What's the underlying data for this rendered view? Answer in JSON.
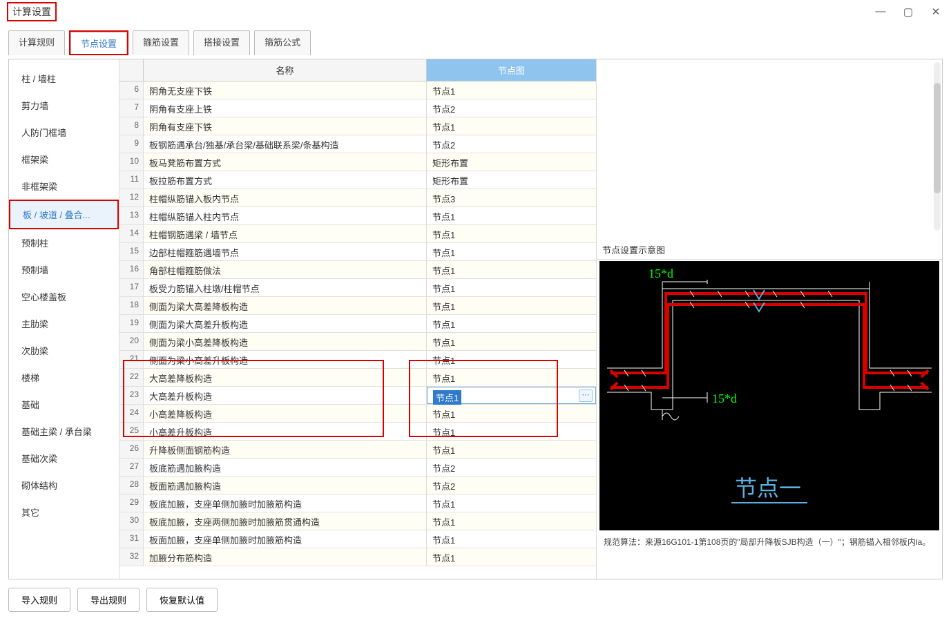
{
  "window": {
    "title": "计算设置"
  },
  "tabs": [
    "计算规则",
    "节点设置",
    "箍筋设置",
    "搭接设置",
    "箍筋公式"
  ],
  "active_tab_index": 1,
  "sidebar": {
    "items": [
      "柱 / 墙柱",
      "剪力墙",
      "人防门框墙",
      "框架梁",
      "非框架梁",
      "板 / 坡道 / 叠合...",
      "预制柱",
      "预制墙",
      "空心楼盖板",
      "主肋梁",
      "次肋梁",
      "楼梯",
      "基础",
      "基础主梁 / 承台梁",
      "基础次梁",
      "砌体结构",
      "其它"
    ],
    "active_index": 5
  },
  "table": {
    "header_name": "名称",
    "header_node": "节点图",
    "rows": [
      {
        "n": 6,
        "name": "阴角无支座下铁",
        "node": "节点1"
      },
      {
        "n": 7,
        "name": "阴角有支座上铁",
        "node": "节点2"
      },
      {
        "n": 8,
        "name": "阴角有支座下铁",
        "node": "节点1"
      },
      {
        "n": 9,
        "name": "板钢筋遇承台/独基/承台梁/基础联系梁/条基构造",
        "node": "节点2"
      },
      {
        "n": 10,
        "name": "板马凳筋布置方式",
        "node": "矩形布置"
      },
      {
        "n": 11,
        "name": "板拉筋布置方式",
        "node": "矩形布置"
      },
      {
        "n": 12,
        "name": "柱帽纵筋锚入板内节点",
        "node": "节点3"
      },
      {
        "n": 13,
        "name": "柱帽纵筋锚入柱内节点",
        "node": "节点1"
      },
      {
        "n": 14,
        "name": "柱帽钢筋遇梁 / 墙节点",
        "node": "节点1"
      },
      {
        "n": 15,
        "name": "边部柱帽箍筋遇墙节点",
        "node": "节点1"
      },
      {
        "n": 16,
        "name": "角部柱帽箍筋做法",
        "node": "节点1"
      },
      {
        "n": 17,
        "name": "板受力筋锚入柱墩/柱帽节点",
        "node": "节点1"
      },
      {
        "n": 18,
        "name": "侧面为梁大高差降板构造",
        "node": "节点1"
      },
      {
        "n": 19,
        "name": "侧面为梁大高差升板构造",
        "node": "节点1"
      },
      {
        "n": 20,
        "name": "侧面为梁小高差降板构造",
        "node": "节点1"
      },
      {
        "n": 21,
        "name": "侧面为梁小高差升板构造",
        "node": "节点1"
      },
      {
        "n": 22,
        "name": "大高差降板构造",
        "node": "节点1"
      },
      {
        "n": 23,
        "name": "大高差升板构造",
        "node": "节点1",
        "editing": true
      },
      {
        "n": 24,
        "name": "小高差降板构造",
        "node": "节点1"
      },
      {
        "n": 25,
        "name": "小高差升板构造",
        "node": "节点1"
      },
      {
        "n": 26,
        "name": "升降板侧面钢筋构造",
        "node": "节点1"
      },
      {
        "n": 27,
        "name": "板底筋遇加腋构造",
        "node": "节点2"
      },
      {
        "n": 28,
        "name": "板面筋遇加腋构造",
        "node": "节点2"
      },
      {
        "n": 29,
        "name": "板底加腋，支座单侧加腋时加腋筋构造",
        "node": "节点1"
      },
      {
        "n": 30,
        "name": "板底加腋，支座两侧加腋时加腋筋贯通构造",
        "node": "节点1"
      },
      {
        "n": 31,
        "name": "板面加腋，支座单侧加腋时加腋筋构造",
        "node": "节点1"
      },
      {
        "n": 32,
        "name": "加腋分布筋构造",
        "node": "节点1"
      }
    ]
  },
  "preview": {
    "title": "节点设置示意图",
    "dim1": "15*d",
    "dim2": "15*d",
    "node_label": "节点一",
    "caption": "规范算法：来源16G101-1第108页的\"局部升降板SJB构造（一）\"；钢筋锚入相邻板内la。"
  },
  "footer": {
    "btn_import": "导入规则",
    "btn_export": "导出规则",
    "btn_reset": "恢复默认值"
  },
  "ellipsis": "⋯"
}
